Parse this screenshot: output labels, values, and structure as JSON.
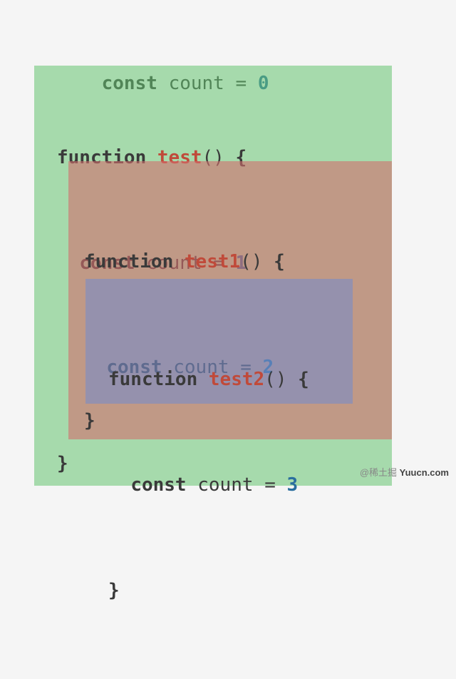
{
  "code": {
    "kw_const": "const",
    "kw_function": "function",
    "var_count": "count",
    "eq": "=",
    "paren_open": "(",
    "paren_close": ")",
    "brace_open": "{",
    "brace_close": "}",
    "fn0": {
      "name": "test",
      "count_val": "0"
    },
    "fn1": {
      "name": "test1",
      "count_val": "1"
    },
    "fn2": {
      "name": "test2",
      "count_val": "2"
    },
    "fn3": {
      "count_val": "3"
    }
  },
  "scopes": {
    "outer_color": "#f5f5f5",
    "green": "#93d39c",
    "red": "#d69f9d",
    "blue": "#99a8cf"
  },
  "watermark": {
    "prefix": "@稀土掘",
    "site": "Yuucn.com"
  }
}
